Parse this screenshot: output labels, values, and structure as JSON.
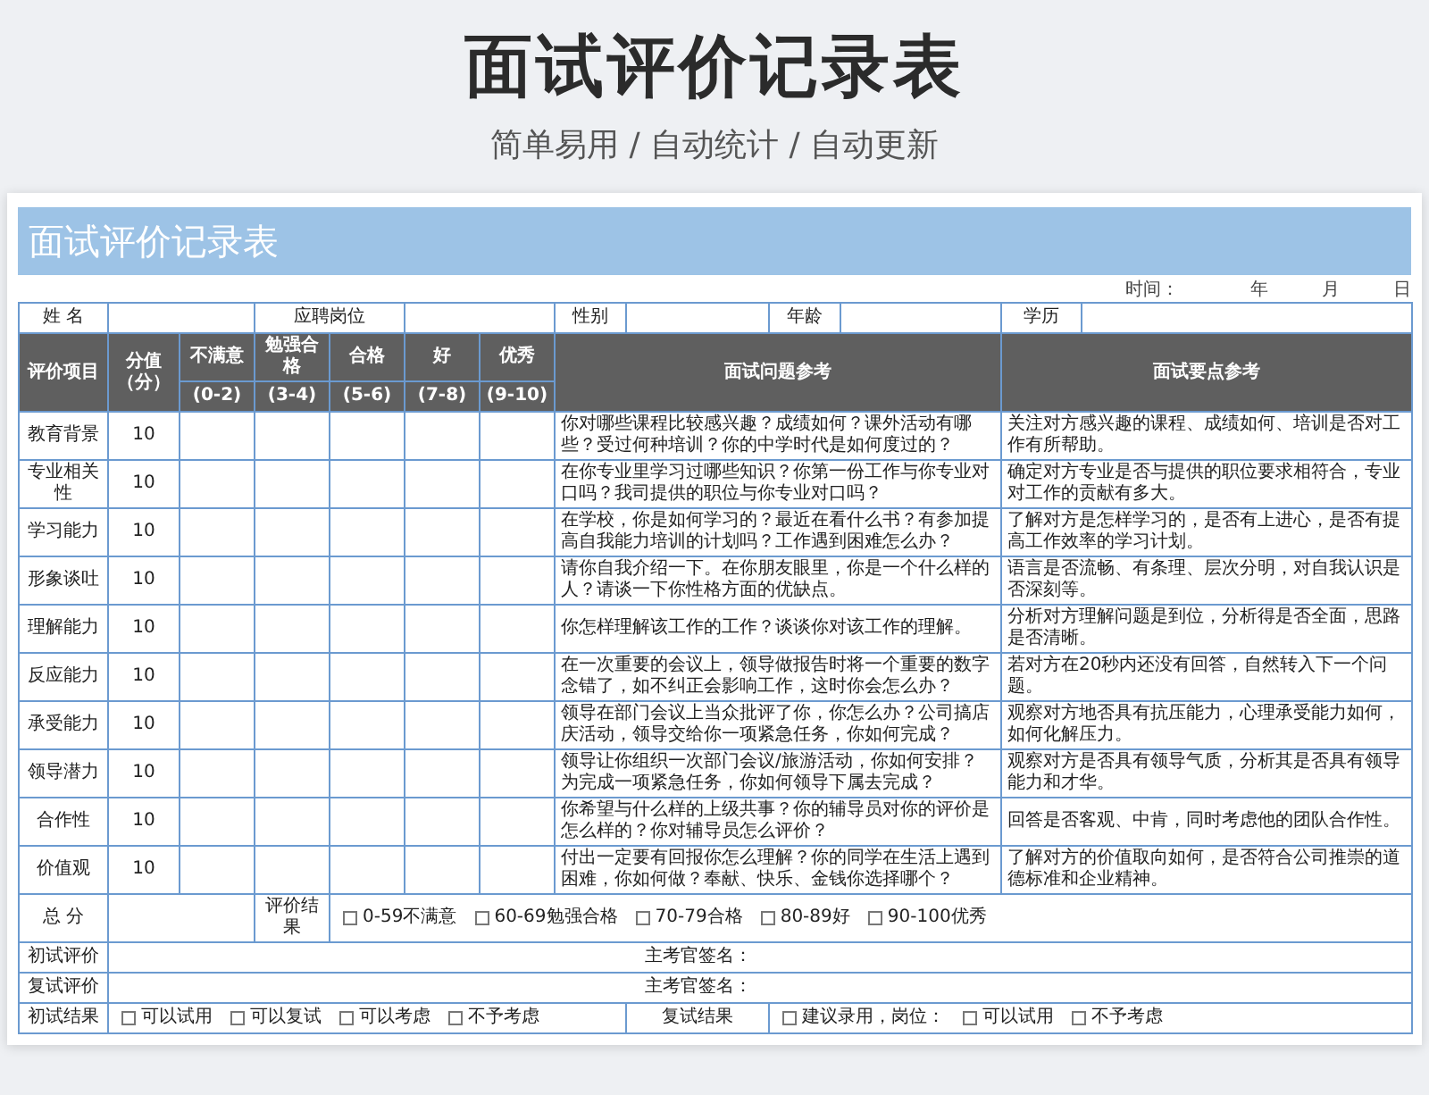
{
  "header": {
    "title": "面试评价记录表",
    "subtitle": "简单易用 / 自动统计 / 自动更新"
  },
  "sheet": {
    "banner": "面试评价记录表",
    "date_line": [
      "时间：",
      "年",
      "月",
      "日"
    ],
    "info_fields": [
      "姓 名",
      "应聘岗位",
      "性别",
      "年龄",
      "学历"
    ],
    "columns": {
      "item": "评价项目",
      "score": "分值（分）",
      "question": "面试问题参考",
      "points": "面试要点参考",
      "levels": [
        {
          "name": "不满意",
          "range": "(0-2)"
        },
        {
          "name": "勉强合格",
          "range": "(3-4)"
        },
        {
          "name": "合格",
          "range": "(5-6)"
        },
        {
          "name": "好",
          "range": "(7-8)"
        },
        {
          "name": "优秀",
          "range": "(9-10)"
        }
      ]
    },
    "rows": [
      {
        "item": "教育背景",
        "score": "10",
        "question": "你对哪些课程比较感兴趣？成绩如何？课外活动有哪些？受过何种培训？你的中学时代是如何度过的？",
        "points": "关注对方感兴趣的课程、成绩如何、培训是否对工作有所帮助。"
      },
      {
        "item": "专业相关性",
        "score": "10",
        "question": "在你专业里学习过哪些知识？你第一份工作与你专业对口吗？我司提供的职位与你专业对口吗？",
        "points": "确定对方专业是否与提供的职位要求相符合，专业对工作的贡献有多大。"
      },
      {
        "item": "学习能力",
        "score": "10",
        "question": "在学校，你是如何学习的？最近在看什么书？有参加提高自我能力培训的计划吗？工作遇到困难怎么办？",
        "points": "了解对方是怎样学习的，是否有上进心，是否有提高工作效率的学习计划。"
      },
      {
        "item": "形象谈吐",
        "score": "10",
        "question": "请你自我介绍一下。在你朋友眼里，你是一个什么样的人？请谈一下你性格方面的优缺点。",
        "points": "语言是否流畅、有条理、层次分明，对自我认识是否深刻等。"
      },
      {
        "item": "理解能力",
        "score": "10",
        "question": "你怎样理解该工作的工作？谈谈你对该工作的理解。",
        "points": "分析对方理解问题是到位，分析得是否全面，思路是否清晰。"
      },
      {
        "item": "反应能力",
        "score": "10",
        "question": "在一次重要的会议上，领导做报告时将一个重要的数字念错了，如不纠正会影响工作，这时你会怎么办？",
        "points": "若对方在20秒内还没有回答，自然转入下一个问题。"
      },
      {
        "item": "承受能力",
        "score": "10",
        "question": "领导在部门会议上当众批评了你，你怎么办？公司搞店庆活动，领导交给你一项紧急任务，你如何完成？",
        "points": "观察对方地否具有抗压能力，心理承受能力如何，如何化解压力。"
      },
      {
        "item": "领导潜力",
        "score": "10",
        "question": "领导让你组织一次部门会议/旅游活动，你如何安排？为完成一项紧急任务，你如何领导下属去完成？",
        "points": "观察对方是否具有领导气质，分析其是否具有领导能力和才华。"
      },
      {
        "item": "合作性",
        "score": "10",
        "question": "你希望与什么样的上级共事？你的辅导员对你的评价是怎么样的？你对辅导员怎么评价？",
        "points": "回答是否客观、中肯，同时考虑他的团队合作性。"
      },
      {
        "item": "价值观",
        "score": "10",
        "question": "付出一定要有回报你怎么理解？你的同学在生活上遇到困难，你如何做？奉献、快乐、金钱你选择哪个？",
        "points": "了解对方的价值取向如何，是否符合公司推崇的道德标准和企业精神。"
      }
    ],
    "total": {
      "label": "总 分",
      "result_label": "评价结果",
      "options": [
        {
          "label": "0-59不满意",
          "checked": false
        },
        {
          "label": "60-69勉强合格",
          "checked": false
        },
        {
          "label": "70-79合格",
          "checked": false
        },
        {
          "label": "80-89好",
          "checked": false
        },
        {
          "label": "90-100优秀",
          "checked": false
        }
      ]
    },
    "reviews": [
      {
        "label": "初试评价",
        "signer": "主考官签名："
      },
      {
        "label": "复试评价",
        "signer": "主考官签名："
      }
    ],
    "outcome": {
      "first_label": "初试结果",
      "first_options": [
        {
          "label": "可以试用",
          "checked": false
        },
        {
          "label": "可以复试",
          "checked": false
        },
        {
          "label": "可以考虑",
          "checked": false
        },
        {
          "label": "不予考虑",
          "checked": false
        }
      ],
      "second_label": "复试结果",
      "second_options": [
        {
          "label": "建议录用，岗位：",
          "checked": false
        },
        {
          "label": "可以试用",
          "checked": false
        },
        {
          "label": "不予考虑",
          "checked": false
        }
      ]
    }
  }
}
